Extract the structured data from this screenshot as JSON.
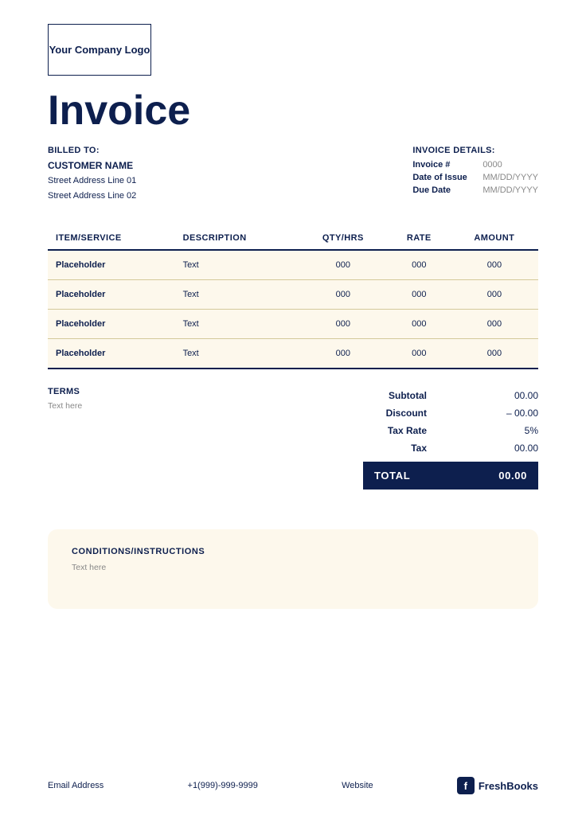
{
  "logo": {
    "text": "Your Company Logo"
  },
  "title": "Invoice",
  "billed_to": {
    "label": "BILLED TO:",
    "customer_name": "CUSTOMER NAME",
    "address_line1": "Street Address Line 01",
    "address_line2": "Street Address Line 02"
  },
  "invoice_details": {
    "label": "INVOICE DETAILS:",
    "fields": [
      {
        "key": "Invoice #",
        "value": "0000"
      },
      {
        "key": "Date of Issue",
        "value": "MM/DD/YYYY"
      },
      {
        "key": "Due Date",
        "value": "MM/DD/YYYY"
      }
    ]
  },
  "table": {
    "headers": [
      "ITEM/SERVICE",
      "DESCRIPTION",
      "QTY/HRS",
      "RATE",
      "AMOUNT"
    ],
    "rows": [
      {
        "item": "Placeholder",
        "desc": "Text",
        "qty": "000",
        "rate": "000",
        "amount": "000"
      },
      {
        "item": "Placeholder",
        "desc": "Text",
        "qty": "000",
        "rate": "000",
        "amount": "000"
      },
      {
        "item": "Placeholder",
        "desc": "Text",
        "qty": "000",
        "rate": "000",
        "amount": "000"
      },
      {
        "item": "Placeholder",
        "desc": "Text",
        "qty": "000",
        "rate": "000",
        "amount": "000"
      }
    ]
  },
  "terms": {
    "label": "TERMS",
    "text": "Text here"
  },
  "totals": {
    "subtotal_label": "Subtotal",
    "subtotal_value": "00.00",
    "discount_label": "Discount",
    "discount_value": "– 00.00",
    "taxrate_label": "Tax Rate",
    "taxrate_value": "5%",
    "tax_label": "Tax",
    "tax_value": "00.00",
    "total_label": "TOTAL",
    "total_value": "00.00"
  },
  "conditions": {
    "label": "CONDITIONS/INSTRUCTIONS",
    "text": "Text here"
  },
  "footer": {
    "email": "Email Address",
    "phone": "+1(999)-999-9999",
    "website": "Website",
    "brand": "FreshBooks",
    "brand_icon": "f"
  }
}
